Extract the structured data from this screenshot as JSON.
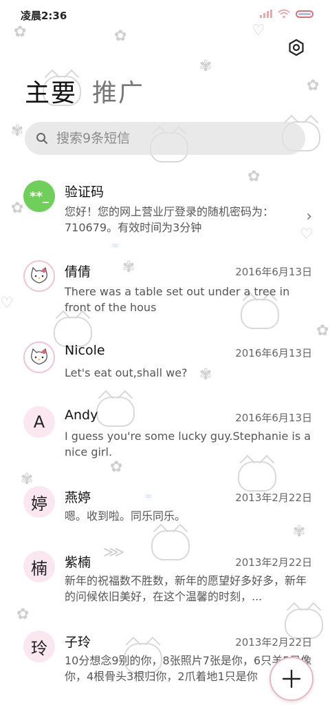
{
  "status_bar": {
    "time": "凌晨2:36"
  },
  "tabs": [
    {
      "label": "主要"
    },
    {
      "label": "推广"
    }
  ],
  "search": {
    "placeholder": "搜索9条短信"
  },
  "conversations": [
    {
      "name": "验证码",
      "avatar_text": "**_",
      "avatar_style": "green",
      "date": "",
      "snippet": "您好！您的网上营业厅登录的随机密码为：710679。有效时间为3分钟"
    },
    {
      "name": "倩倩",
      "avatar_text": "",
      "avatar_style": "kitty",
      "date": "2016年6月13日",
      "snippet": "There was a table set out under a tree in front of the hous"
    },
    {
      "name": "Nicole",
      "avatar_text": "",
      "avatar_style": "kitty",
      "date": "2016年6月13日",
      "snippet": "Let's eat out,shall we?"
    },
    {
      "name": "Andy",
      "avatar_text": "A",
      "avatar_style": "pink",
      "date": "2016年6月13日",
      "snippet": "I guess you're some lucky guy.Stephanie is a nice girl."
    },
    {
      "name": "燕婷",
      "avatar_text": "婷",
      "avatar_style": "pink",
      "date": "2013年2月22日",
      "snippet": "嗯。收到啦。同乐同乐。"
    },
    {
      "name": "紫楠",
      "avatar_text": "楠",
      "avatar_style": "pink",
      "date": "2013年2月22日",
      "snippet": "新年的祝福数不胜数，新年的愿望好多好多，新年的问候依旧美好，在这个温馨的时刻，..."
    },
    {
      "name": "子玲",
      "avatar_text": "玲",
      "avatar_style": "pink",
      "date": "2013年2月22日",
      "snippet": "10分想念9别的你，8张照片7张是你，6只羊5只像你，4根骨头3根归你，2爪着地1只是你"
    }
  ],
  "icons": {
    "settings": "gear-icon",
    "search": "search-icon",
    "compose": "plus-icon",
    "chevron": "chevron-right-icon"
  },
  "colors": {
    "accent_green": "#6fcf5a",
    "avatar_pink": "#fbe7ef",
    "fab_border": "#e8b7c2"
  }
}
